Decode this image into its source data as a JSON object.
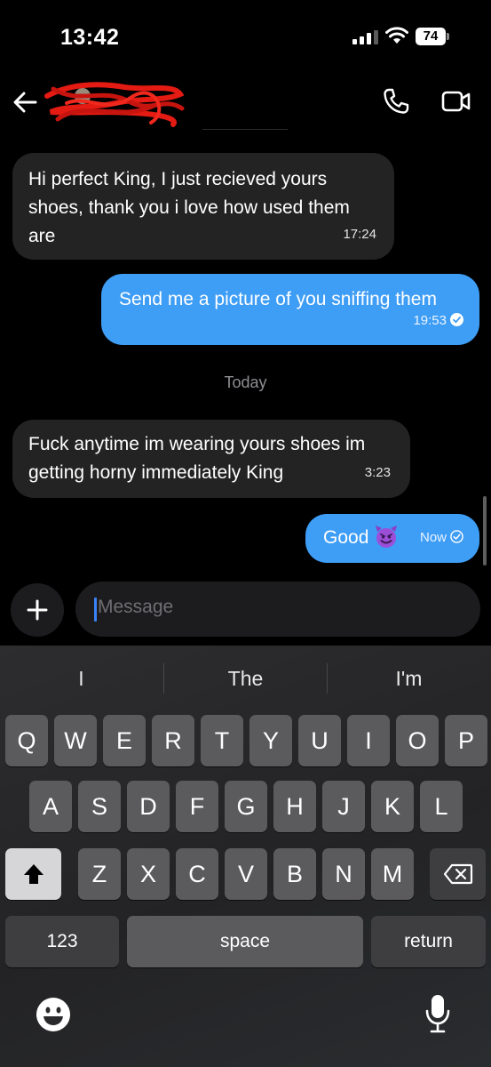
{
  "status_bar": {
    "time": "13:42",
    "battery": "74"
  },
  "header": {
    "contact_name_redacted": true
  },
  "messages": [
    {
      "direction": "incoming",
      "text": "Hi perfect King, I just recieved yours shoes, thank you i love how used them are",
      "time": "17:24"
    },
    {
      "direction": "outgoing",
      "text": "Send me a picture of you sniffing them",
      "time": "19:53",
      "status": "read"
    },
    {
      "direction": "incoming",
      "text": "Fuck anytime im wearing yours shoes im getting horny immediately King",
      "time": "3:23"
    },
    {
      "direction": "outgoing",
      "text": "Good",
      "emoji": "smiling-devil",
      "time": "Now",
      "status": "sent"
    }
  ],
  "day_separator": "Today",
  "composer": {
    "placeholder": "Message"
  },
  "keyboard": {
    "suggestions": [
      "I",
      "The",
      "I'm"
    ],
    "row1": [
      "Q",
      "W",
      "E",
      "R",
      "T",
      "Y",
      "U",
      "I",
      "O",
      "P"
    ],
    "row2": [
      "A",
      "S",
      "D",
      "F",
      "G",
      "H",
      "J",
      "K",
      "L"
    ],
    "row3": [
      "Z",
      "X",
      "C",
      "V",
      "B",
      "N",
      "M"
    ],
    "numbers_label": "123",
    "space_label": "space",
    "return_label": "return"
  },
  "colors": {
    "outgoing_bubble": "#3e9df5",
    "incoming_bubble": "#232323",
    "background": "#000000",
    "caret": "#3b82f6"
  }
}
